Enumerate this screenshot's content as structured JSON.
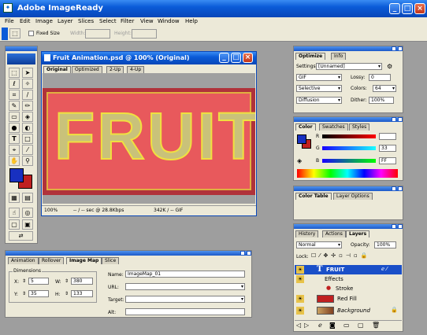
{
  "app": {
    "title": "Adobe ImageReady"
  },
  "menu": [
    "File",
    "Edit",
    "Image",
    "Layer",
    "Slices",
    "Select",
    "Filter",
    "View",
    "Window",
    "Help"
  ],
  "options_bar": {
    "fixed_size": "Fixed Size",
    "width_label": "Width:",
    "height_label": "Height:"
  },
  "document": {
    "title": "Fruit Animation.psd @ 100% (Original)",
    "tabs": [
      "Original",
      "Optimized",
      "2-Up",
      "4-Up"
    ],
    "canvas_text": "FRUIT",
    "status": {
      "zoom": "100%",
      "time": "-- / -- sec @ 28.8Kbps",
      "size": "342K / -- GIF"
    }
  },
  "optimize_panel": {
    "tabs": [
      "Optimize",
      "Info"
    ],
    "settings_label": "Settings:",
    "settings_value": "[Unnamed]",
    "format": "GIF",
    "lossy_label": "Lossy:",
    "lossy_value": "0",
    "reduction": "Selective",
    "colors_label": "Colors:",
    "colors_value": "64",
    "dither_algo": "Diffusion",
    "dither_label": "Dither:",
    "dither_value": "100%"
  },
  "color_panel": {
    "tabs": [
      "Color",
      "Swatches",
      "Styles"
    ],
    "channels": [
      {
        "label": "R",
        "value": ""
      },
      {
        "label": "G",
        "value": "33"
      },
      {
        "label": "B",
        "value": "FF"
      }
    ]
  },
  "color_table_panel": {
    "tabs": [
      "Color Table",
      "Layer Options"
    ]
  },
  "layers_panel": {
    "tabs": [
      "History",
      "Actions",
      "Layers"
    ],
    "blend_mode": "Normal",
    "opacity_label": "Opacity:",
    "opacity_value": "100%",
    "lock_label": "Lock:",
    "layers": [
      {
        "name": "FRUIT",
        "kind": "text",
        "selected": true
      },
      {
        "name": "Effects",
        "kind": "effects"
      },
      {
        "name": "Stroke",
        "kind": "effect"
      },
      {
        "name": "Red Fill",
        "kind": "fill"
      },
      {
        "name": "Background",
        "kind": "background"
      }
    ]
  },
  "imagemap_panel": {
    "tabs": [
      "Animation",
      "Rollover",
      "Image Map",
      "Slice"
    ],
    "dimensions_label": "Dimensions",
    "x_label": "X:",
    "x_value": "5",
    "y_label": "Y:",
    "y_value": "35",
    "w_label": "W:",
    "w_value": "380",
    "h_label": "H:",
    "h_value": "133",
    "name_label": "Name:",
    "name_value": "ImageMap_01",
    "url_label": "URL:",
    "target_label": "Target:",
    "alt_label": "Alt:"
  },
  "colors": {
    "canvas_bg": "#b0323a",
    "canvas_fill": "#e8595c",
    "accent_blue": "#0a5bd8"
  }
}
